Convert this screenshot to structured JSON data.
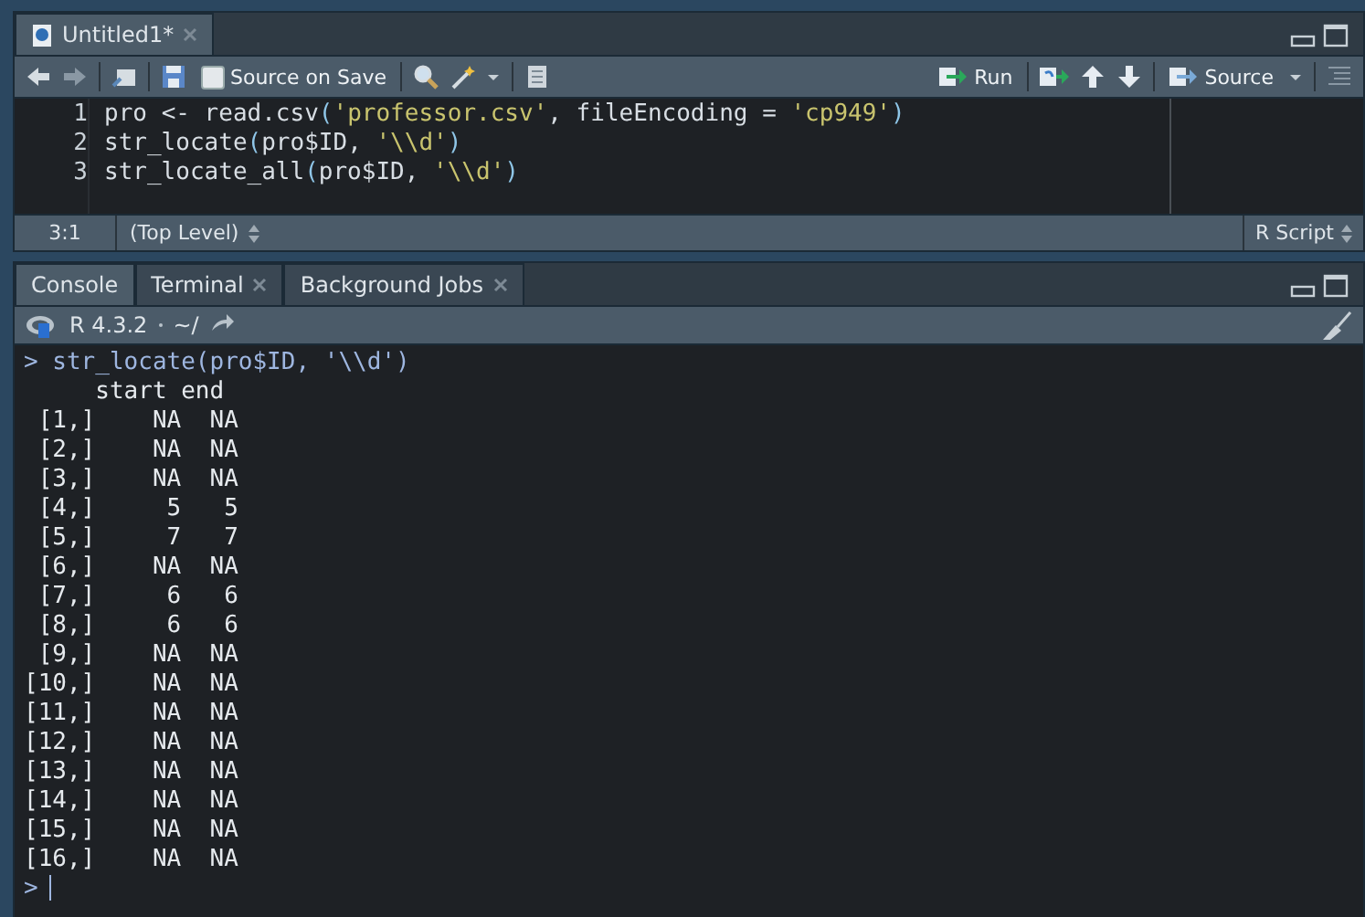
{
  "editor": {
    "tabs": [
      {
        "label": "Untitled1*",
        "selected": true
      }
    ],
    "toolbar": {
      "source_on_save": {
        "label": "Source on Save",
        "checked": false
      },
      "run": "Run",
      "source": "Source"
    },
    "lines": [
      {
        "number": "1",
        "tokens": [
          {
            "kind": "id",
            "text": "pro "
          },
          {
            "kind": "op",
            "text": "<-"
          },
          {
            "kind": "id",
            "text": " read.csv"
          },
          {
            "kind": "paren",
            "text": "("
          },
          {
            "kind": "str",
            "text": "'professor.csv'"
          },
          {
            "kind": "id",
            "text": ", fileEncoding "
          },
          {
            "kind": "op",
            "text": "= "
          },
          {
            "kind": "str",
            "text": "'cp949'"
          },
          {
            "kind": "paren",
            "text": ")"
          }
        ]
      },
      {
        "number": "2",
        "tokens": [
          {
            "kind": "id",
            "text": "str_locate"
          },
          {
            "kind": "paren",
            "text": "("
          },
          {
            "kind": "id",
            "text": "pro$ID, "
          },
          {
            "kind": "str",
            "text": "'\\\\d'"
          },
          {
            "kind": "paren",
            "text": ")"
          }
        ]
      },
      {
        "number": "3",
        "tokens": [
          {
            "kind": "id",
            "text": "str_locate_all"
          },
          {
            "kind": "paren",
            "text": "("
          },
          {
            "kind": "id",
            "text": "pro$ID, "
          },
          {
            "kind": "str",
            "text": "'\\\\d'"
          },
          {
            "kind": "paren",
            "text": ")"
          }
        ]
      }
    ],
    "status": {
      "position": "3:1",
      "scope": "(Top Level)",
      "file_type": "R Script"
    }
  },
  "console": {
    "tabs": [
      {
        "label": "Console",
        "selected": true,
        "closable": false
      },
      {
        "label": "Terminal",
        "selected": false,
        "closable": true
      },
      {
        "label": "Background Jobs",
        "selected": false,
        "closable": true
      }
    ],
    "version": "R 4.3.2",
    "path": "~/",
    "lines": [
      {
        "kind": "input",
        "prompt": ">",
        "text": "str_locate(pro$ID, '\\\\d')"
      },
      {
        "kind": "output",
        "text": "     start end"
      },
      {
        "kind": "output",
        "text": " [1,]    NA  NA"
      },
      {
        "kind": "output",
        "text": " [2,]    NA  NA"
      },
      {
        "kind": "output",
        "text": " [3,]    NA  NA"
      },
      {
        "kind": "output",
        "text": " [4,]     5   5"
      },
      {
        "kind": "output",
        "text": " [5,]     7   7"
      },
      {
        "kind": "output",
        "text": " [6,]    NA  NA"
      },
      {
        "kind": "output",
        "text": " [7,]     6   6"
      },
      {
        "kind": "output",
        "text": " [8,]     6   6"
      },
      {
        "kind": "output",
        "text": " [9,]    NA  NA"
      },
      {
        "kind": "output",
        "text": "[10,]    NA  NA"
      },
      {
        "kind": "output",
        "text": "[11,]    NA  NA"
      },
      {
        "kind": "output",
        "text": "[12,]    NA  NA"
      },
      {
        "kind": "output",
        "text": "[13,]    NA  NA"
      },
      {
        "kind": "output",
        "text": "[14,]    NA  NA"
      },
      {
        "kind": "output",
        "text": "[15,]    NA  NA"
      },
      {
        "kind": "output",
        "text": "[16,]    NA  NA"
      },
      {
        "kind": "prompt",
        "prompt": ">"
      }
    ]
  }
}
